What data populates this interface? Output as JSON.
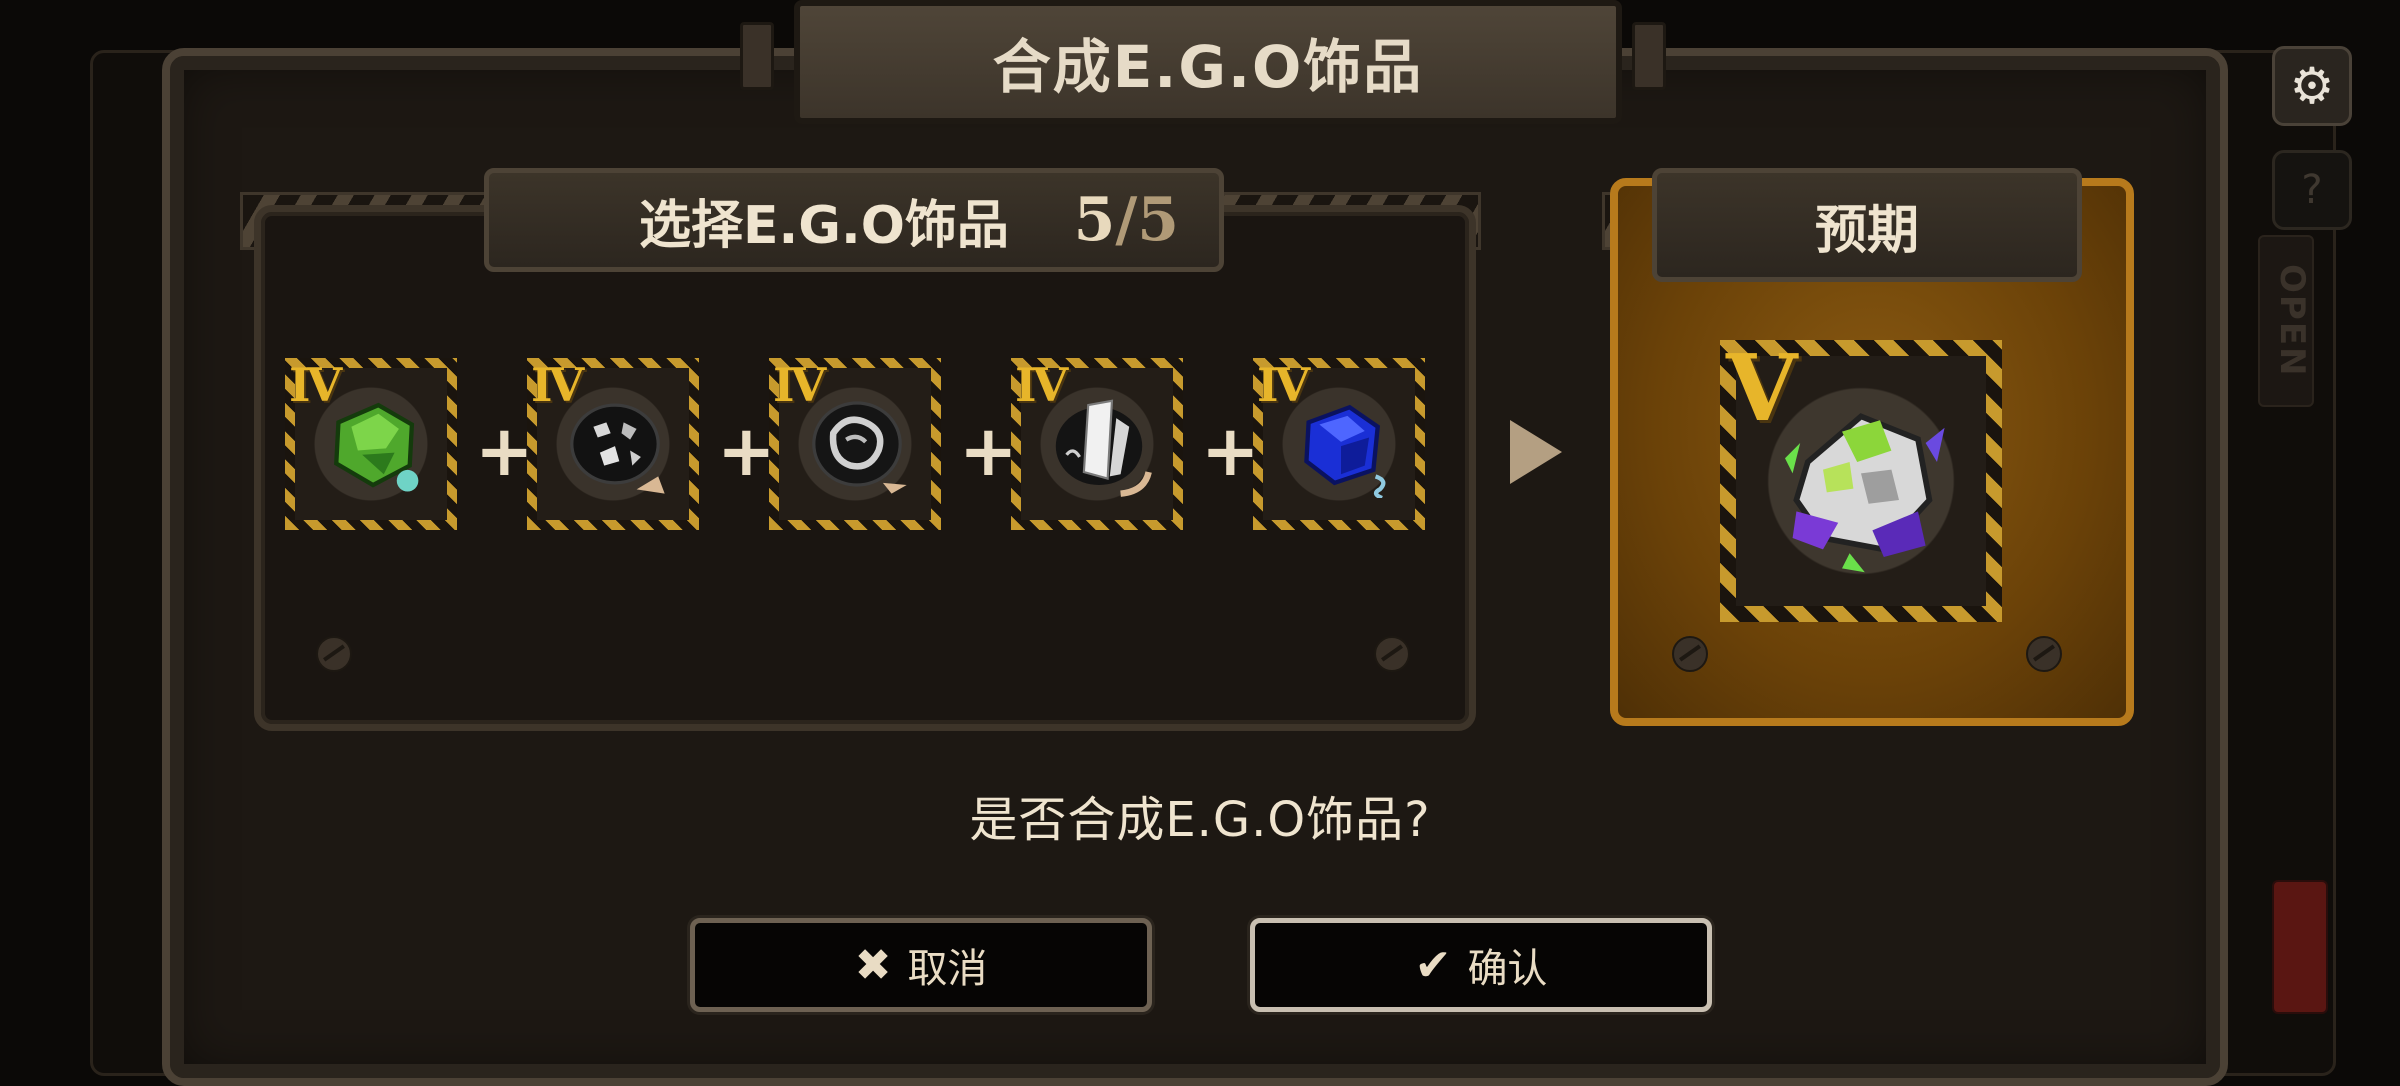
{
  "dialog": {
    "title": "合成E.G.O饰品",
    "select_label": "选择E.G.O饰品",
    "count_current": "5",
    "count_sep": "/",
    "count_total": "5",
    "preview_label": "预期",
    "question": "是否合成E.G.O饰品?",
    "cancel_label": "取消",
    "confirm_label": "确认"
  },
  "items": [
    {
      "tier": "IV",
      "icon": "green-crystal-icon"
    },
    {
      "tier": "IV",
      "icon": "black-rock-icon"
    },
    {
      "tier": "IV",
      "icon": "grey-ore-icon"
    },
    {
      "tier": "IV",
      "icon": "white-shard-icon"
    },
    {
      "tier": "IV",
      "icon": "blue-crystal-icon"
    }
  ],
  "result": {
    "tier": "V",
    "icon": "mixed-crystal-rock-icon"
  },
  "side": {
    "settings_icon": "gear-icon",
    "help_icon": "question-icon",
    "tag_text": "OPEN"
  },
  "colors": {
    "accent_gold": "#e7b52a",
    "preview_bg": "#6b4208"
  }
}
